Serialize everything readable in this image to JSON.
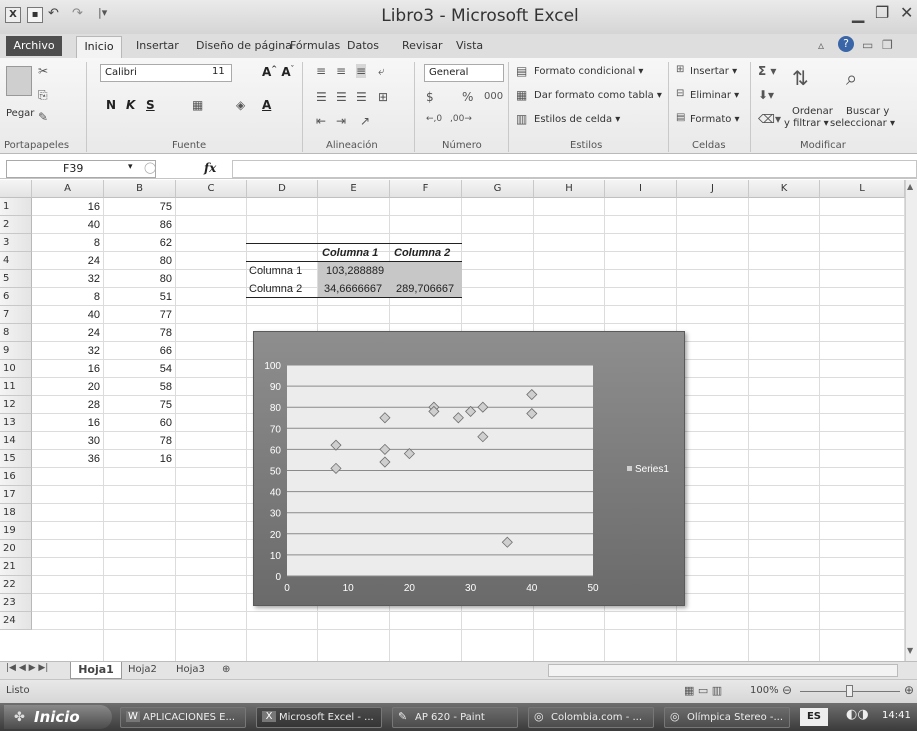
{
  "window": {
    "title": "Libro3 - Microsoft Excel",
    "app_icon": "excel-icon",
    "quick_access": [
      "save-icon",
      "undo-icon",
      "redo-icon",
      "customize-icon"
    ]
  },
  "tabs": [
    "Archivo",
    "Inicio",
    "Insertar",
    "Diseño de página",
    "Fórmulas",
    "Datos",
    "Revisar",
    "Vista"
  ],
  "ribbon": {
    "clipboard": {
      "paste": "Pegar",
      "group": "Portapapeles"
    },
    "font": {
      "name": "Calibri",
      "size": "11",
      "bold": "N",
      "italic": "K",
      "underline": "S",
      "group": "Fuente"
    },
    "alignment": {
      "group": "Alineación"
    },
    "number": {
      "format": "General",
      "group": "Número"
    },
    "styles": {
      "cond": "Formato condicional ▾",
      "table": "Dar formato como tabla ▾",
      "cellstyles": "Estilos de celda ▾",
      "group": "Estilos"
    },
    "cells": {
      "insert": "Insertar ▾",
      "delete": "Eliminar ▾",
      "format": "Formato ▾",
      "group": "Celdas"
    },
    "editing": {
      "sort": "Ordenar",
      "sort2": "y filtrar ▾",
      "find": "Buscar y",
      "find2": "seleccionar ▾",
      "group": "Modificar"
    }
  },
  "formula_bar": {
    "name_box": "F39",
    "fx": "fx",
    "value": ""
  },
  "columns": [
    "A",
    "B",
    "C",
    "D",
    "E",
    "F",
    "G",
    "H",
    "I",
    "J",
    "K",
    "L"
  ],
  "rows": [
    "1",
    "2",
    "3",
    "4",
    "5",
    "6",
    "7",
    "8",
    "9",
    "10",
    "11",
    "12",
    "13",
    "14",
    "15",
    "16",
    "17",
    "18",
    "19",
    "20",
    "21",
    "22",
    "23",
    "24"
  ],
  "col_a": [
    "16",
    "40",
    "8",
    "24",
    "32",
    "8",
    "40",
    "24",
    "32",
    "16",
    "20",
    "28",
    "16",
    "30",
    "36"
  ],
  "col_b": [
    "75",
    "86",
    "62",
    "80",
    "80",
    "51",
    "77",
    "78",
    "66",
    "54",
    "58",
    "75",
    "60",
    "78",
    "16"
  ],
  "covariance": {
    "header1": "Columna 1",
    "header2": "Columna 2",
    "row1_label": "Columna 1",
    "row1_e": "103,288889",
    "row2_label": "Columna 2",
    "row2_e": "34,6666667",
    "row2_f": "289,706667"
  },
  "chart_data": {
    "type": "scatter",
    "title": "",
    "xlabel": "",
    "ylabel": "",
    "xlim": [
      0,
      50
    ],
    "ylim": [
      0,
      100
    ],
    "x_ticks": [
      "0",
      "10",
      "20",
      "30",
      "40",
      "50"
    ],
    "y_ticks": [
      "0",
      "10",
      "20",
      "30",
      "40",
      "50",
      "60",
      "70",
      "80",
      "90",
      "100"
    ],
    "grid": "horizontal",
    "legend": "right",
    "series": [
      {
        "name": "Series1",
        "marker": "diamond",
        "color": "#cfcfcf",
        "x": [
          16,
          40,
          8,
          24,
          32,
          8,
          40,
          24,
          32,
          16,
          20,
          28,
          16,
          30,
          36
        ],
        "y": [
          75,
          86,
          62,
          80,
          80,
          51,
          77,
          78,
          66,
          54,
          58,
          75,
          60,
          78,
          16
        ]
      }
    ]
  },
  "sheets": [
    "Hoja1",
    "Hoja2",
    "Hoja3"
  ],
  "status": {
    "ready": "Listo",
    "zoom": "100%"
  },
  "taskbar": {
    "start": "Inicio",
    "items": [
      "APLICACIONES E...",
      "Microsoft Excel - ...",
      "AP 620 - Paint",
      "Colombia.com - ...",
      "Olímpica Stereo -..."
    ],
    "lang": "ES",
    "clock": "14:41"
  }
}
